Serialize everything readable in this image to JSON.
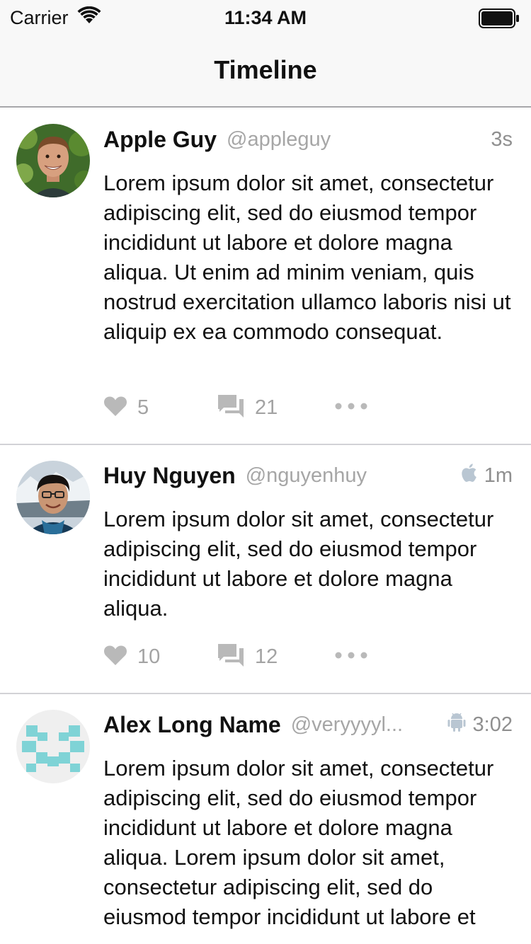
{
  "status_bar": {
    "carrier": "Carrier",
    "time": "11:34 AM",
    "icons": [
      "wifi-icon",
      "battery-icon"
    ]
  },
  "nav": {
    "title": "Timeline"
  },
  "colors": {
    "bar_background": "#f8f8f8",
    "secondary_text": "#a6a6a6",
    "icon_gray": "#b8b8b8",
    "separator": "#d2d2d6"
  },
  "posts": [
    {
      "name": "Apple Guy",
      "handle": "@appleguy",
      "time": "3s",
      "platform_icon": null,
      "text": "Lorem ipsum dolor sit amet, consectetur adipiscing elit, sed do eiusmod tempor incididunt ut labore et dolore magna aliqua. Ut enim ad minim veniam, quis nostrud exercitation ullamco laboris nisi ut aliquip ex ea commodo consequat.",
      "likes": "5",
      "comments": "21"
    },
    {
      "name": "Huy Nguyen",
      "handle": "@nguyenhuy",
      "time": "1m",
      "platform_icon": "apple-icon",
      "text": "Lorem ipsum dolor sit amet, consectetur adipiscing elit, sed do eiusmod tempor incididunt ut labore et dolore magna aliqua.",
      "likes": "10",
      "comments": "12"
    },
    {
      "name": "Alex Long Name",
      "handle": "@veryyyyl...",
      "time": "3:02",
      "platform_icon": "android-icon",
      "text": "Lorem ipsum dolor sit amet, consectetur adipiscing elit, sed do eiusmod tempor incididunt ut labore et dolore magna aliqua. Lorem ipsum dolor sit amet, consectetur adipiscing elit, sed do eiusmod tempor incididunt ut labore et",
      "likes": "",
      "comments": ""
    }
  ]
}
